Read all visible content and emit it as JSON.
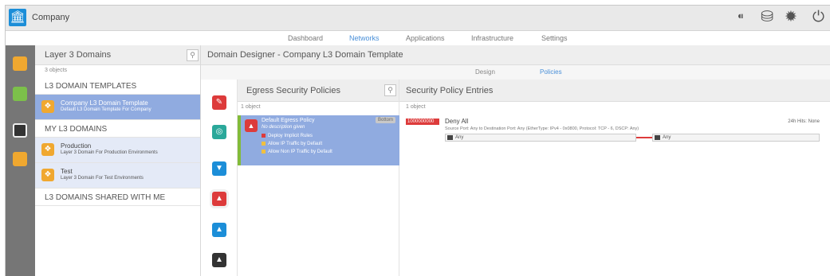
{
  "header": {
    "company": "Company",
    "icons": [
      "activity-icon",
      "database-icon",
      "gear-cluster-icon",
      "power-icon"
    ]
  },
  "nav": {
    "tabs": [
      {
        "label": "Dashboard",
        "active": false
      },
      {
        "label": "Networks",
        "active": true
      },
      {
        "label": "Applications",
        "active": false
      },
      {
        "label": "Infrastructure",
        "active": false
      },
      {
        "label": "Settings",
        "active": false
      }
    ]
  },
  "domains": {
    "title": "Layer 3 Domains",
    "count": "3 objects",
    "templates_header": "L3 DOMAIN TEMPLATES",
    "template": {
      "name": "Company L3 Domain Template",
      "desc": "Default L3 Domain Template For Company"
    },
    "my_header": "MY L3 DOMAINS",
    "items": [
      {
        "name": "Production",
        "desc": "Layer 3 Domain For Production Environments"
      },
      {
        "name": "Test",
        "desc": "Layer 3 Domain For Test Environments"
      }
    ],
    "shared_header": "L3 DOMAINS SHARED WITH ME"
  },
  "designer": {
    "title": "Domain Designer - Company L3 Domain Template",
    "subtabs": [
      {
        "label": "Design",
        "active": false
      },
      {
        "label": "Policies",
        "active": true
      }
    ]
  },
  "egress": {
    "title": "Egress Security Policies",
    "count": "1 object",
    "policy": {
      "name": "Default Egress Policy",
      "desc": "No description given",
      "tag": "Bottom",
      "options": [
        "Deploy Implicit Rules",
        "Allow IP Traffic by Default",
        "Allow Non IP Traffic by Default"
      ]
    }
  },
  "entries": {
    "title": "Security Policy Entries",
    "count": "1 object",
    "entry": {
      "priority": "1000000000",
      "name": "Deny All",
      "desc": "Source Port: Any to Destination Port: Any (EtherType: IPv4 - 0x0800, Protocol: TCP - 6, DSCP: Any)",
      "hits": "24h Hits: None",
      "source": "Any",
      "destination": "Any"
    }
  },
  "colors": {
    "accent": "#4a90d9",
    "selected": "#90abe0",
    "deny": "#dd3b3b",
    "rail": "#767676",
    "domain_icon": "#f0a830"
  }
}
